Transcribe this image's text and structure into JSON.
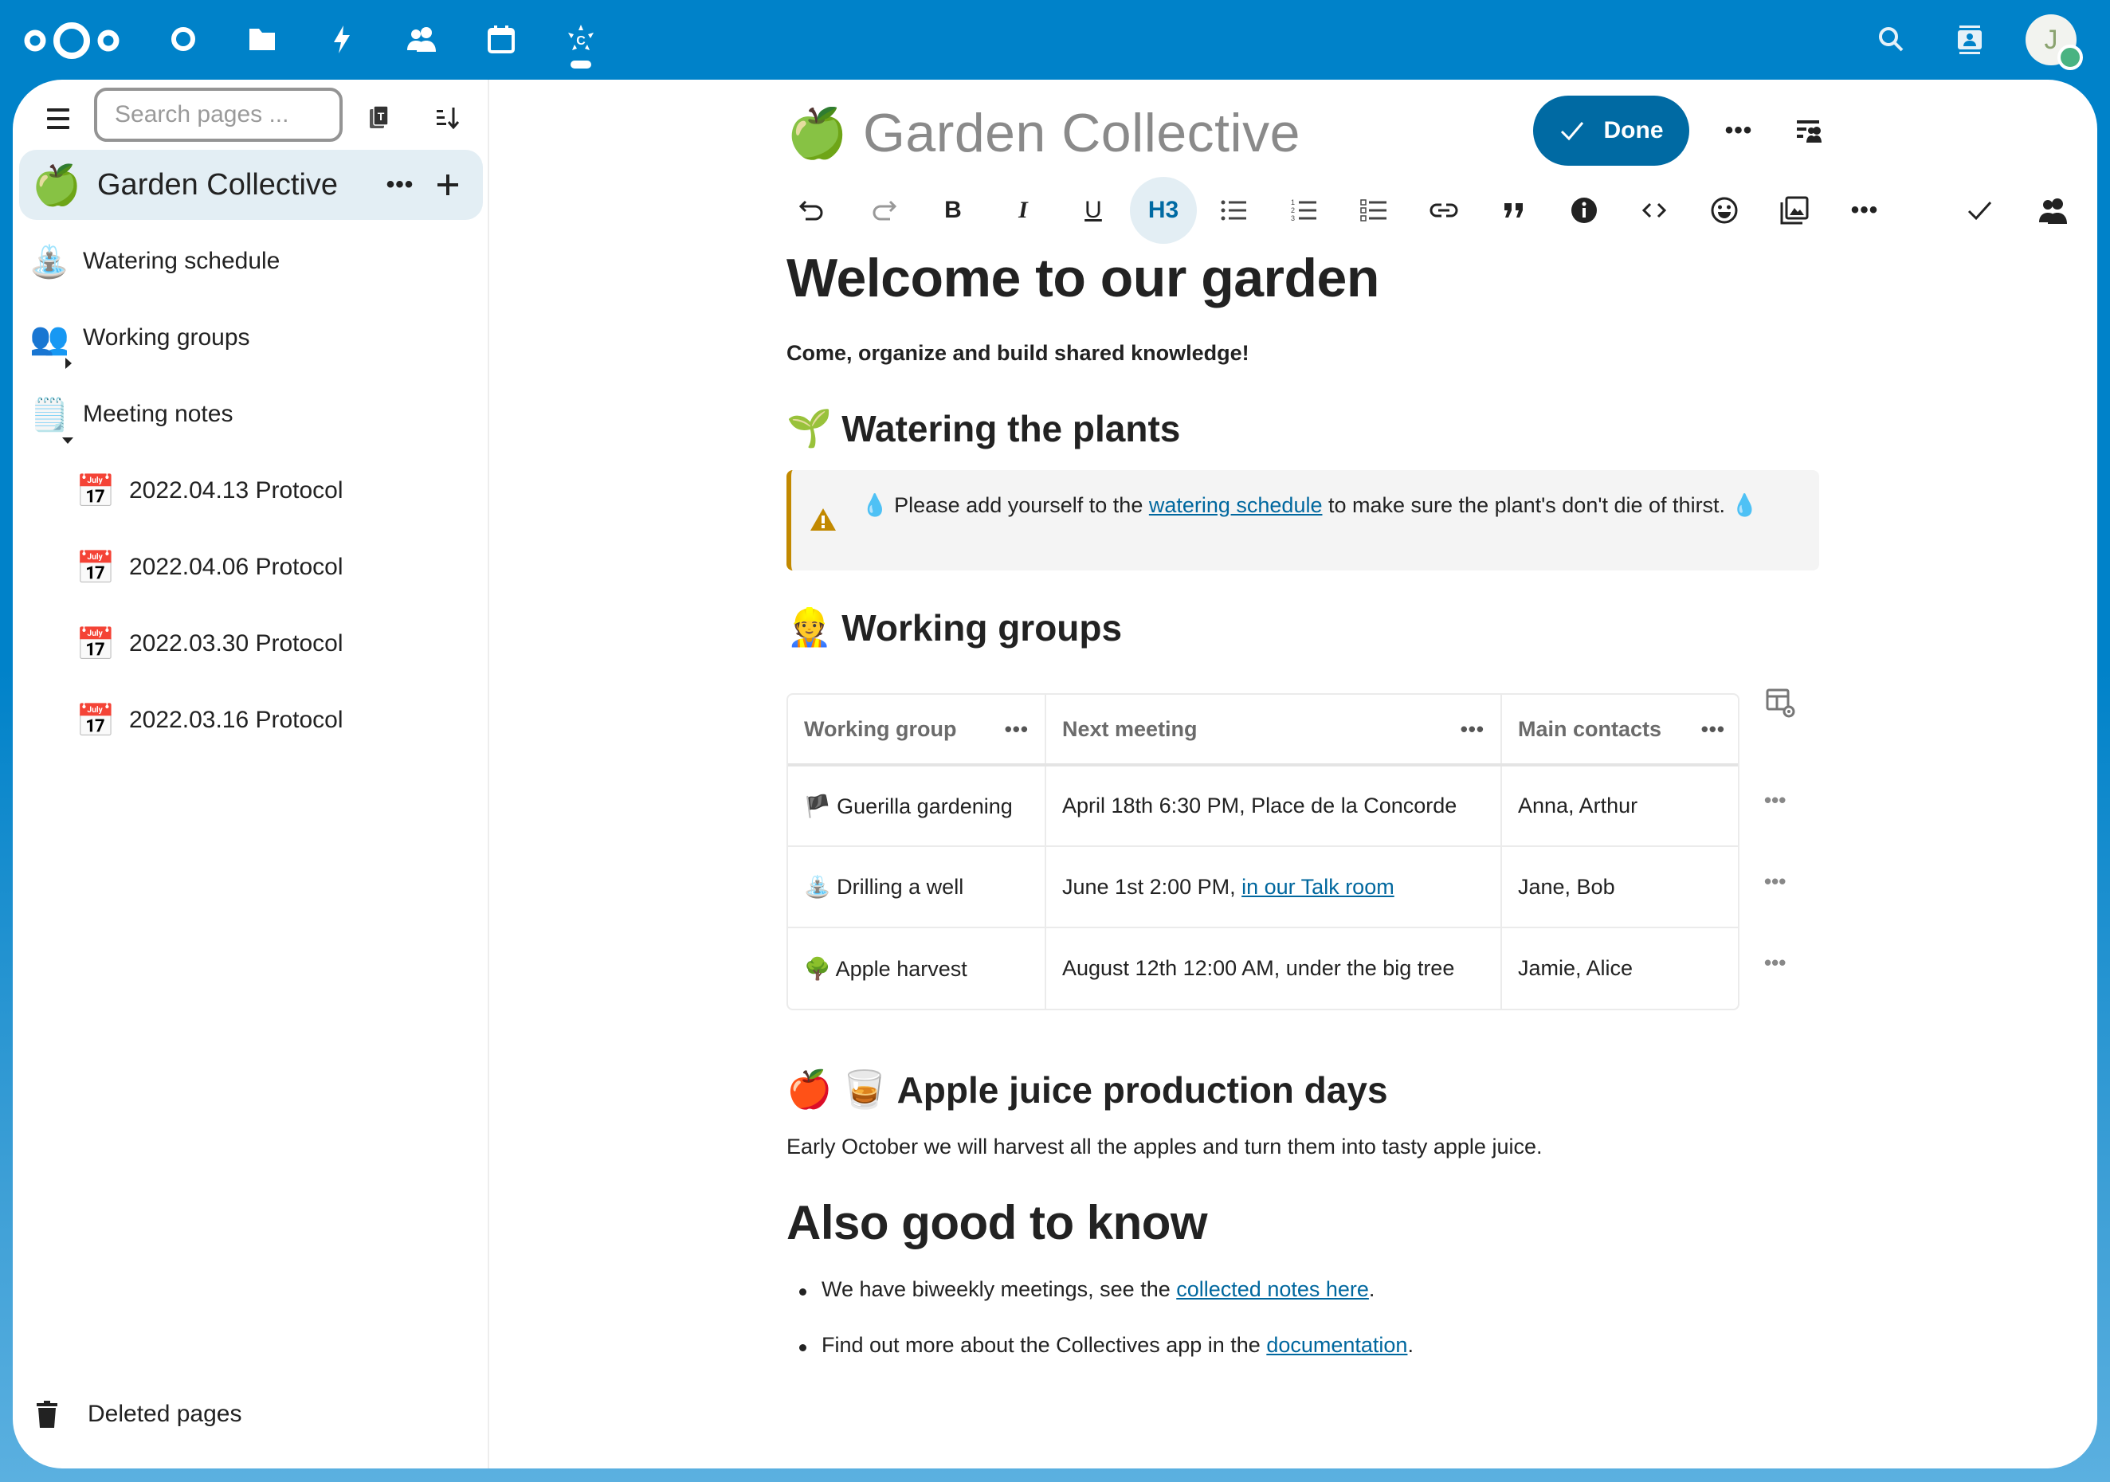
{
  "header": {
    "apps": [
      {
        "name": "dashboard",
        "icon": "circle-icon"
      },
      {
        "name": "files",
        "icon": "folder-icon"
      },
      {
        "name": "activity",
        "icon": "lightning-icon"
      },
      {
        "name": "contacts",
        "icon": "people-icon"
      },
      {
        "name": "calendar",
        "icon": "calendar-icon"
      },
      {
        "name": "collectives",
        "icon": "collectives-icon",
        "active": true
      }
    ],
    "avatar_initial": "J",
    "accent_color": "#0082c9"
  },
  "sidebar": {
    "search_placeholder": "Search pages ...",
    "collective": {
      "emoji": "🍏",
      "label": "Garden Collective"
    },
    "pages": [
      {
        "emoji": "⛲",
        "label": "Watering schedule"
      },
      {
        "emoji": "👥",
        "label": "Working groups",
        "expander": "collapsed"
      },
      {
        "emoji": "🗒️",
        "label": "Meeting notes",
        "expander": "expanded",
        "children": [
          {
            "emoji": "📅",
            "label": "2022.04.13 Protocol"
          },
          {
            "emoji": "📅",
            "label": "2022.04.06 Protocol"
          },
          {
            "emoji": "📅",
            "label": "2022.03.30 Protocol"
          },
          {
            "emoji": "📅",
            "label": "2022.03.16 Protocol"
          }
        ]
      }
    ],
    "deleted_label": "Deleted pages"
  },
  "page": {
    "emoji": "🍏",
    "title": "Garden Collective",
    "done_label": "Done",
    "toolbar": {
      "heading_label": "H3",
      "bold_label": "B",
      "italic_label": "I",
      "underline_label": "U"
    }
  },
  "content": {
    "h1": "Welcome to our garden",
    "subtitle": "Come, organize and build shared knowledge!",
    "watering": {
      "emoji": "🌱",
      "heading": "Watering the plants",
      "callout": {
        "drop": "💧",
        "before": "Please add yourself to the ",
        "link": "watering schedule",
        "after": " to make sure the plant's don't die of thirst. "
      }
    },
    "groups": {
      "emoji": "👷",
      "heading": "Working groups",
      "columns": [
        "Working group",
        "Next meeting",
        "Main contacts"
      ],
      "rows": [
        {
          "emoji": "🏴",
          "group": "Guerilla gardening",
          "meeting": "April 18th 6:30 PM, Place de la Concorde",
          "meeting_link": "",
          "contacts": "Anna, Arthur"
        },
        {
          "emoji": "⛲",
          "group": "Drilling a well",
          "meeting": "June 1st 2:00 PM, ",
          "meeting_link": "in our Talk room",
          "contacts": "Jane, Bob"
        },
        {
          "emoji": "🌳",
          "group": "Apple harvest",
          "meeting": "August 12th 12:00 AM, under the big tree",
          "meeting_link": "",
          "contacts": "Jamie, Alice"
        }
      ]
    },
    "juice": {
      "emoji1": "🍎",
      "emoji2": "🥃",
      "heading": "Apple juice production days",
      "text": "Early October we will harvest all the apples and turn them into tasty apple juice."
    },
    "also": {
      "heading": "Also good to know",
      "bullets": [
        {
          "before": "We have biweekly meetings, see the ",
          "link": "collected notes here",
          "after": "."
        },
        {
          "before": "Find out more about the Collectives app in the ",
          "link": "documentation",
          "after": "."
        }
      ]
    }
  }
}
